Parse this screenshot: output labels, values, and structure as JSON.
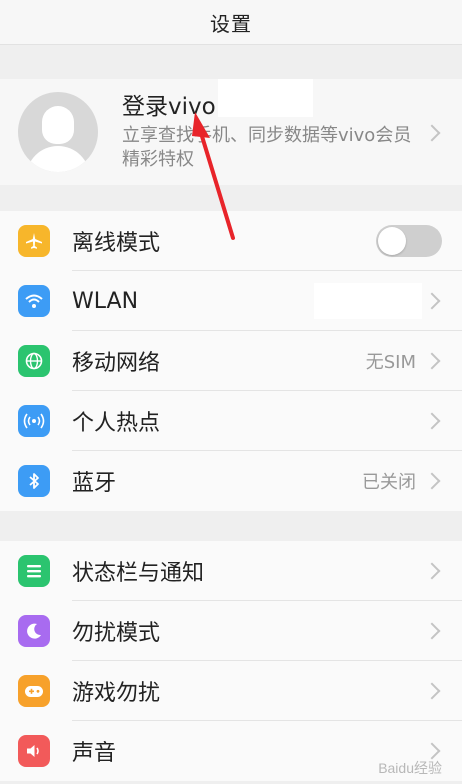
{
  "header": {
    "title": "设置"
  },
  "account": {
    "title": "登录vivo",
    "subtitle": "立享查找手机、同步数据等vivo会员精彩特权"
  },
  "group1": [
    {
      "label": "离线模式",
      "icon": "airplane-icon",
      "color": "#f7b62b",
      "control": "toggle",
      "toggle_on": false
    },
    {
      "label": "WLAN",
      "icon": "wifi-icon",
      "color": "#3d9cf5",
      "control": "chevron",
      "value": ""
    },
    {
      "label": "移动网络",
      "icon": "globe-icon",
      "color": "#2bc46f",
      "control": "chevron",
      "value": "无SIM"
    },
    {
      "label": "个人热点",
      "icon": "hotspot-icon",
      "color": "#3d9cf5",
      "control": "chevron",
      "value": ""
    },
    {
      "label": "蓝牙",
      "icon": "bluetooth-icon",
      "color": "#3d9cf5",
      "control": "chevron",
      "value": "已关闭"
    }
  ],
  "group2": [
    {
      "label": "状态栏与通知",
      "icon": "list-icon",
      "color": "#2bc46f"
    },
    {
      "label": "勿扰模式",
      "icon": "moon-icon",
      "color": "#a86bf0"
    },
    {
      "label": "游戏勿扰",
      "icon": "gamepad-icon",
      "color": "#f7a12b"
    },
    {
      "label": "声音",
      "icon": "speaker-icon",
      "color": "#f25a5a"
    }
  ],
  "watermark": "Baidu经验"
}
